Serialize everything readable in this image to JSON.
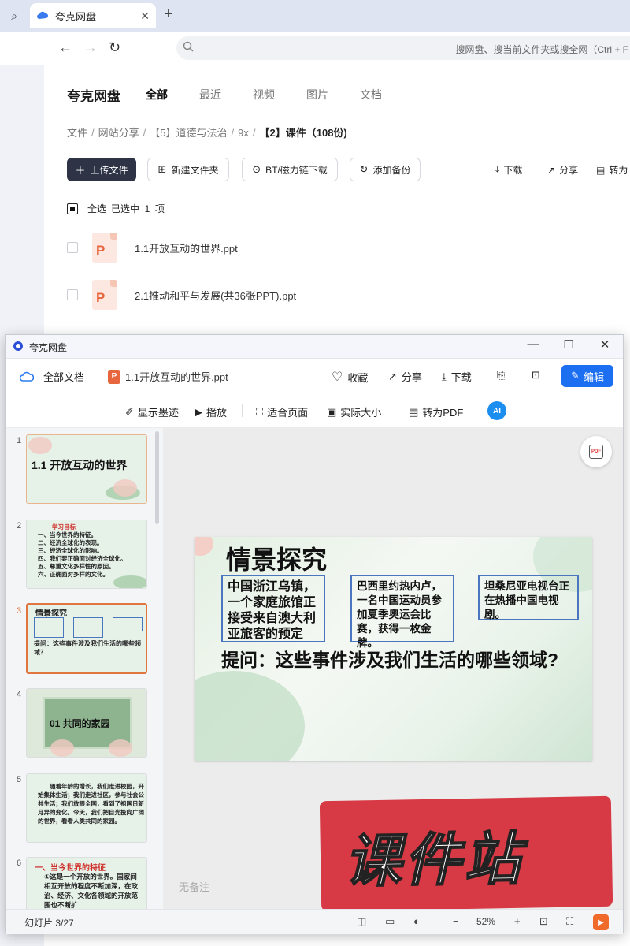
{
  "browser": {
    "tab_title": "夸克网盘",
    "new_tab_icon": "plus-icon",
    "back_icon": "back-arrow-icon",
    "forward_icon": "forward-arrow-icon",
    "reload_icon": "reload-icon",
    "address_placeholder": "搜网盘、搜当前文件夹或搜全网（Ctrl + F"
  },
  "drive": {
    "brand": "夸克网盘",
    "nav": [
      "全部",
      "最近",
      "视频",
      "图片",
      "文档"
    ],
    "breadcrumb": [
      "文件",
      "网站分享",
      "【5】道德与法治",
      "9x"
    ],
    "breadcrumb_current": "【2】课件（108份)",
    "upload_label": "上传文件",
    "new_folder_label": "新建文件夹",
    "bt_label": "BT/磁力链下载",
    "backup_label": "添加备份",
    "download_label": "下载",
    "share_label": "分享",
    "topdf_label": "转为",
    "select_all_label": "全选",
    "selected_text": "已选中  1  项",
    "files": [
      {
        "name": "1.1开放互动的世界.ppt"
      },
      {
        "name": "2.1推动和平与发展(共36张PPT).ppt"
      }
    ]
  },
  "viewer": {
    "window_title": "夸克网盘",
    "all_docs_label": "全部文档",
    "file_title": "1.1开放互动的世界.ppt",
    "file_badge": "P",
    "favorite_label": "收藏",
    "share_label": "分享",
    "download_label": "下载",
    "edit_label": "编辑",
    "show_ink_label": "显示墨迹",
    "play_label": "播放",
    "fit_page_label": "适合页面",
    "actual_size_label": "实际大小",
    "to_pdf_label": "转为PDF",
    "ai_label": "AI",
    "notes_placeholder": "无备注",
    "slide_counter": "幻灯片 3/27",
    "zoom": "52%",
    "watermark_text": "课件站",
    "thumbnails": [
      {
        "num": "1",
        "title": "1.1  开放互动的世界"
      },
      {
        "num": "2",
        "heading": "学习目标",
        "lines": [
          "一、当今世界的特征。",
          "二、经济全球化的表现。",
          "三、经济全球化的影响。",
          "四、我们要正确面对经济全球化。",
          "五、尊重文化多样性的原因。",
          "六、正确面对多样的文化。"
        ]
      },
      {
        "num": "3",
        "title": "情景探究",
        "question": "提问：这些事件涉及我们生活的哪些领域？"
      },
      {
        "num": "4",
        "title": "01  共同的家园"
      },
      {
        "num": "5",
        "text": "随着年龄的增长，我们走进校园，开始集体生活；我们走进社区，参与社会公共生活；我们放眼全国，看到了祖国日新月异的变化。今天，我们把目光投向广阔的世界，看看人类共同的家园。"
      },
      {
        "num": "6",
        "heading": "一、当今世界的特征",
        "text": "①这是一个开放的世界。国家间相互开放的程度不断加深，在政治、经济、文化各领域的开放范围也不断扩"
      }
    ],
    "slide": {
      "title": "情景探究",
      "box1": "中国浙江乌镇，一个家庭旅馆正接受来自澳大利亚旅客的预定",
      "box2": "巴西里约热内卢，一名中国运动员参加夏季奥运会比赛，获得一枚金牌。",
      "box3": "坦桑尼亚电视台正在热播中国电视剧。",
      "question": "提问：这些事件涉及我们生活的哪些领域?"
    }
  }
}
